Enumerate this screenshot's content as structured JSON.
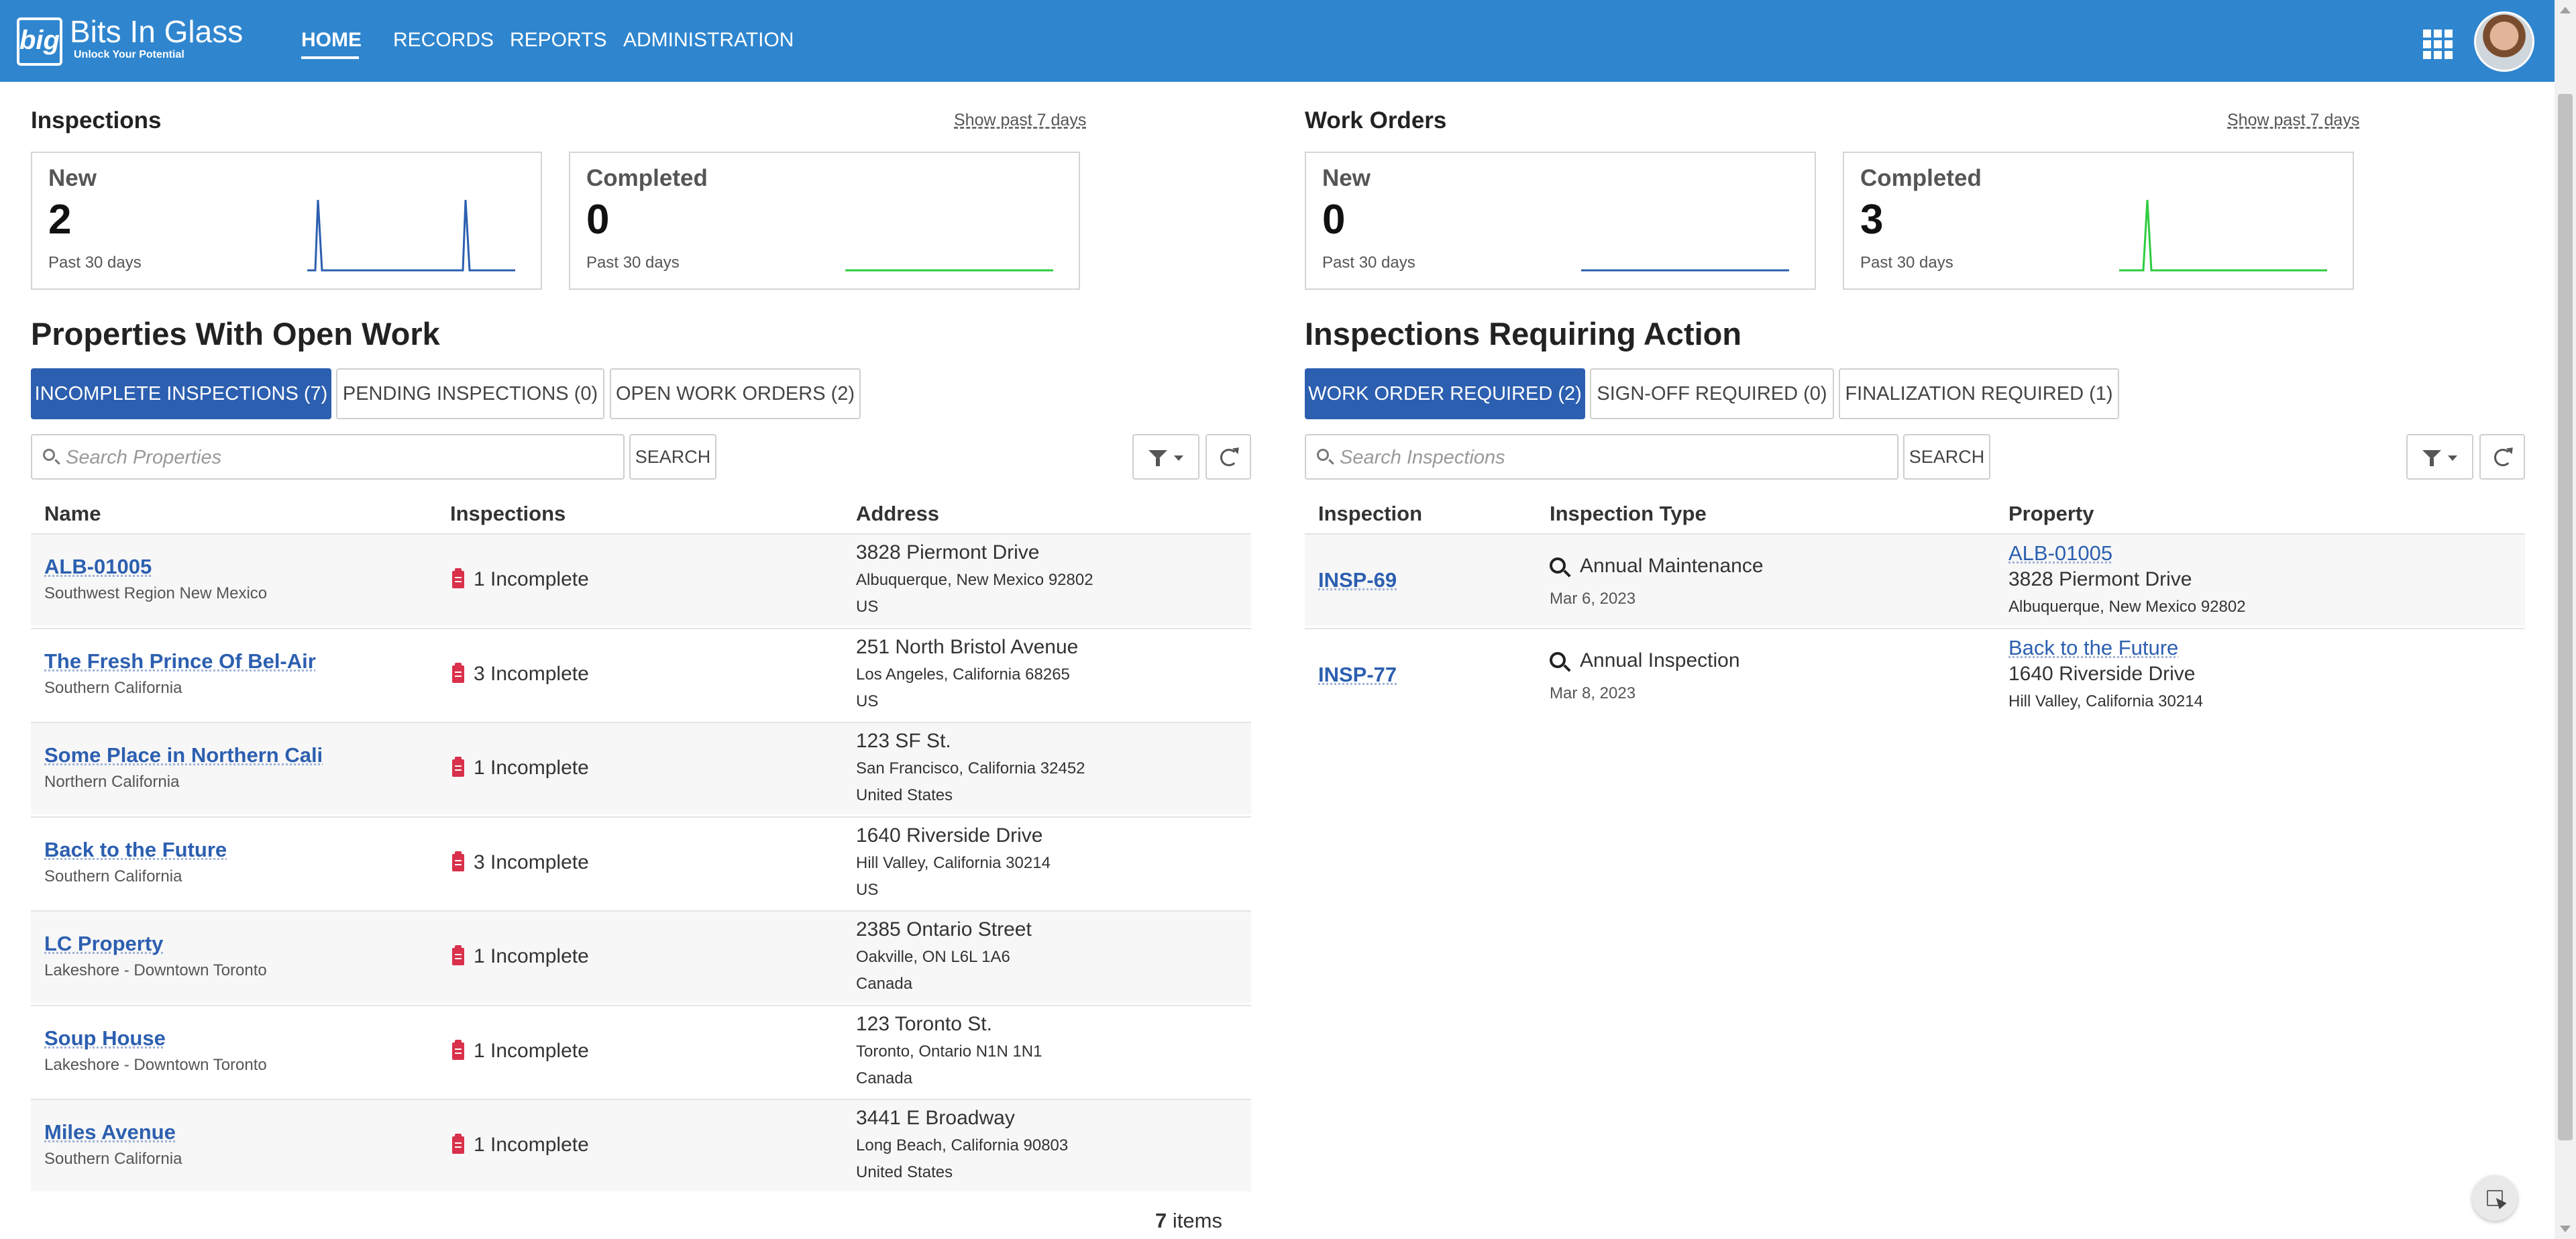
{
  "brand": {
    "name": "Bits In Glass",
    "tagline": "Unlock Your Potential",
    "logo_text": "big"
  },
  "nav": [
    {
      "label": "HOME"
    },
    {
      "label": "RECORDS"
    },
    {
      "label": "REPORTS"
    },
    {
      "label": "ADMINISTRATION"
    }
  ],
  "inspections": {
    "title": "Inspections",
    "show_link": "Show past 7 days",
    "new": {
      "label": "New",
      "value": "2",
      "sub": "Past 30 days"
    },
    "completed": {
      "label": "Completed",
      "value": "0",
      "sub": "Past 30 days"
    }
  },
  "work_orders": {
    "title": "Work Orders",
    "show_link": "Show past 7 days",
    "new": {
      "label": "New",
      "value": "0",
      "sub": "Past 30 days"
    },
    "completed": {
      "label": "Completed",
      "value": "3",
      "sub": "Past 30 days"
    }
  },
  "properties": {
    "title": "Properties With Open Work",
    "tabs": [
      {
        "label": "INCOMPLETE INSPECTIONS (7)",
        "active": true
      },
      {
        "label": "PENDING INSPECTIONS (0)",
        "active": false
      },
      {
        "label": "OPEN WORK ORDERS (2)",
        "active": false
      }
    ],
    "search_placeholder": "Search Properties",
    "search_label": "SEARCH",
    "columns": [
      "Name",
      "Inspections",
      "Address"
    ],
    "rows": [
      {
        "name": "ALB-01005",
        "region": "Southwest Region New Mexico",
        "inspections": "1 Incomplete",
        "address1": "3828 Piermont Drive",
        "address2": "Albuquerque, New Mexico 92802",
        "country": "US"
      },
      {
        "name": "The Fresh Prince Of Bel-Air",
        "region": "Southern California",
        "inspections": "3 Incomplete",
        "address1": "251 North Bristol Avenue",
        "address2": "Los Angeles, California 68265",
        "country": "US"
      },
      {
        "name": "Some Place in Northern Cali",
        "region": "Northern California",
        "inspections": "1 Incomplete",
        "address1": "123 SF St.",
        "address2": "San Francisco, California 32452",
        "country": "United States"
      },
      {
        "name": "Back to the Future",
        "region": "Southern California",
        "inspections": "3 Incomplete",
        "address1": "1640 Riverside Drive",
        "address2": "Hill Valley, California 30214",
        "country": "US"
      },
      {
        "name": "LC Property",
        "region": "Lakeshore - Downtown Toronto",
        "inspections": "1 Incomplete",
        "address1": "2385 Ontario Street",
        "address2": "Oakville, ON L6L 1A6",
        "country": "Canada"
      },
      {
        "name": "Soup House",
        "region": "Lakeshore - Downtown Toronto",
        "inspections": "1 Incomplete",
        "address1": "123 Toronto St.",
        "address2": "Toronto, Ontario N1N 1N1",
        "country": "Canada"
      },
      {
        "name": "Miles Avenue",
        "region": "Southern California",
        "inspections": "1 Incomplete",
        "address1": "3441 E Broadway",
        "address2": "Long Beach, California 90803",
        "country": "United States"
      }
    ],
    "item_count": "7",
    "item_label": "items"
  },
  "inspections_action": {
    "title": "Inspections Requiring Action",
    "tabs": [
      {
        "label": "WORK ORDER REQUIRED (2)",
        "active": true
      },
      {
        "label": "SIGN-OFF REQUIRED (0)",
        "active": false
      },
      {
        "label": "FINALIZATION REQUIRED (1)",
        "active": false
      }
    ],
    "search_placeholder": "Search Inspections",
    "search_label": "SEARCH",
    "columns": [
      "Inspection",
      "Inspection Type",
      "Property"
    ],
    "rows": [
      {
        "id": "INSP-69",
        "type": "Annual Maintenance",
        "date": "Mar 6, 2023",
        "property": "ALB-01005",
        "address1": "3828 Piermont Drive",
        "address2": "Albuquerque, New Mexico 92802"
      },
      {
        "id": "INSP-77",
        "type": "Annual Inspection",
        "date": "Mar 8, 2023",
        "property": "Back to the Future",
        "address1": "1640 Riverside Drive",
        "address2": "Hill Valley, California 30214"
      }
    ]
  },
  "colors": {
    "header": "#2f86cf",
    "active_tab": "#2c5fb0",
    "link": "#2c5fb0",
    "spark_blue": "#2c5fb0",
    "spark_green": "#2ecc40",
    "incomplete_badge": "#d9304b"
  },
  "icons": [
    "apps-grid-icon",
    "user-avatar",
    "search-icon",
    "filter-icon",
    "refresh-icon",
    "clipboard-icon",
    "magnifier-icon",
    "cursor-select-icon"
  ]
}
